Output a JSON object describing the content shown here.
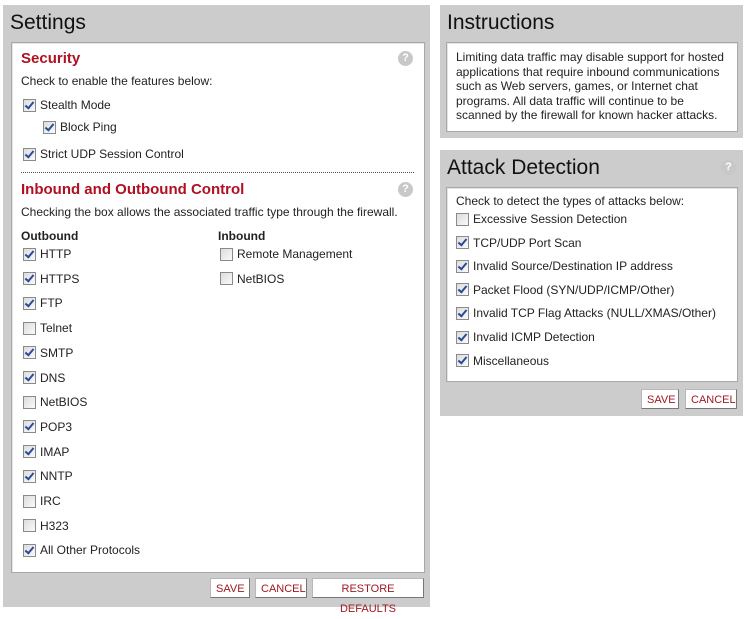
{
  "settings": {
    "title": "Settings",
    "security": {
      "title": "Security",
      "description": "Check to enable the features below:",
      "options": [
        {
          "label": "Stealth Mode",
          "checked": true,
          "indent": 0
        },
        {
          "label": "Block Ping",
          "checked": true,
          "indent": 1
        },
        {
          "label": "Strict UDP Session Control",
          "checked": true,
          "indent": 0
        }
      ]
    },
    "traffic": {
      "title": "Inbound and Outbound Control",
      "description": "Checking the box allows the associated traffic type through the firewall.",
      "outbound_heading": "Outbound",
      "inbound_heading": "Inbound",
      "outbound": [
        {
          "label": "HTTP",
          "checked": true
        },
        {
          "label": "HTTPS",
          "checked": true
        },
        {
          "label": "FTP",
          "checked": true
        },
        {
          "label": "Telnet",
          "checked": false
        },
        {
          "label": "SMTP",
          "checked": true
        },
        {
          "label": "DNS",
          "checked": true
        },
        {
          "label": "NetBIOS",
          "checked": false
        },
        {
          "label": "POP3",
          "checked": true
        },
        {
          "label": "IMAP",
          "checked": true
        },
        {
          "label": "NNTP",
          "checked": true
        },
        {
          "label": "IRC",
          "checked": false
        },
        {
          "label": "H323",
          "checked": false
        },
        {
          "label": "All Other Protocols",
          "checked": true
        }
      ],
      "inbound": [
        {
          "label": "Remote Management",
          "checked": false
        },
        {
          "label": "NetBIOS",
          "checked": false
        }
      ]
    },
    "buttons": {
      "save": "SAVE",
      "cancel": "CANCEL",
      "restore": "RESTORE DEFAULTS"
    }
  },
  "instructions": {
    "title": "Instructions",
    "lines": [
      "Limiting data traffic may disable support for hosted",
      "applications that require inbound communications",
      "such as Web servers, games, or Internet chat",
      "programs. All data traffic will continue to be",
      "scanned by the firewall for known hacker attacks."
    ]
  },
  "attack_detection": {
    "title": "Attack Detection",
    "description": "Check to detect the types of attacks below:",
    "options": [
      {
        "label": "Excessive Session Detection",
        "checked": false
      },
      {
        "label": "TCP/UDP Port Scan",
        "checked": true
      },
      {
        "label": "Invalid Source/Destination IP address",
        "checked": true
      },
      {
        "label": "Packet Flood (SYN/UDP/ICMP/Other)",
        "checked": true
      },
      {
        "label": "Invalid TCP Flag Attacks (NULL/XMAS/Other)",
        "checked": true
      },
      {
        "label": "Invalid ICMP Detection",
        "checked": true
      },
      {
        "label": "Miscellaneous",
        "checked": true
      }
    ],
    "buttons": {
      "save": "SAVE",
      "cancel": "CANCEL"
    }
  },
  "icons": {
    "help": "?"
  }
}
